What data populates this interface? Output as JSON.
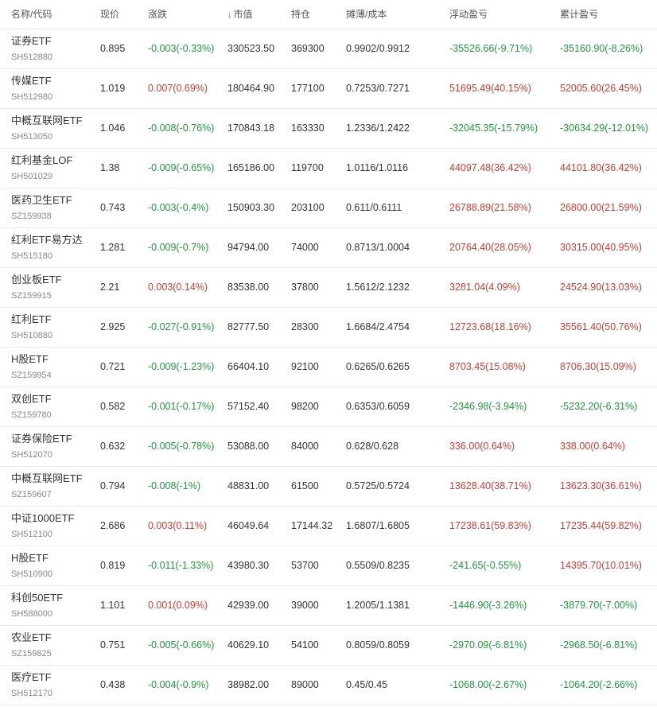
{
  "header": {
    "name_code": "名称/代码",
    "price": "现价",
    "change": "涨跌",
    "market_value": "市值",
    "holding": "持仓",
    "cost": "摊薄/成本",
    "floating_pl": "浮动盈亏",
    "total_pl": "累计盈亏",
    "sort_icon": "↓"
  },
  "colors": {
    "up": "#d43a30",
    "down": "#1f9a3c",
    "accent": "#1a73e8"
  },
  "rows": [
    {
      "name": "证券ETF",
      "code": "SH512880",
      "price": "0.895",
      "change": "-0.003(-0.33%)",
      "mv": "330523.50",
      "hold": "369300",
      "cost": "0.9902/0.9912",
      "float": "-35526.66(-9.71%)",
      "total": "-35160.90(-8.26%)"
    },
    {
      "name": "传媒ETF",
      "code": "SH512980",
      "price": "1.019",
      "change": "0.007(0.69%)",
      "mv": "180464.90",
      "hold": "177100",
      "cost": "0.7253/0.7271",
      "float": "51695.49(40.15%)",
      "total": "52005.60(26.45%)"
    },
    {
      "name": "中概互联网ETF",
      "code": "SH513050",
      "price": "1.046",
      "change": "-0.008(-0.76%)",
      "mv": "170843.18",
      "hold": "163330",
      "cost": "1.2336/1.2422",
      "float": "-32045.35(-15.79%)",
      "total": "-30634.29(-12.01%)"
    },
    {
      "name": "红利基金LOF",
      "code": "SH501029",
      "price": "1.38",
      "change": "-0.009(-0.65%)",
      "mv": "165186.00",
      "hold": "119700",
      "cost": "1.0116/1.0116",
      "float": "44097.48(36.42%)",
      "total": "44101.80(36.42%)"
    },
    {
      "name": "医药卫生ETF",
      "code": "SZ159938",
      "price": "0.743",
      "change": "-0.003(-0.4%)",
      "mv": "150903.30",
      "hold": "203100",
      "cost": "0.611/0.6111",
      "float": "26788.89(21.58%)",
      "total": "26800.00(21.59%)"
    },
    {
      "name": "红利ETF易方达",
      "code": "SH515180",
      "price": "1.281",
      "change": "-0.009(-0.7%)",
      "mv": "94794.00",
      "hold": "74000",
      "cost": "0.8713/1.0004",
      "float": "20764.40(28.05%)",
      "total": "30315.00(40.95%)"
    },
    {
      "name": "创业板ETF",
      "code": "SZ159915",
      "price": "2.21",
      "change": "0.003(0.14%)",
      "mv": "83538.00",
      "hold": "37800",
      "cost": "1.5612/2.1232",
      "float": "3281.04(4.09%)",
      "total": "24524.90(13.03%)"
    },
    {
      "name": "红利ETF",
      "code": "SH510880",
      "price": "2.925",
      "change": "-0.027(-0.91%)",
      "mv": "82777.50",
      "hold": "28300",
      "cost": "1.6684/2.4754",
      "float": "12723.68(18.16%)",
      "total": "35561.40(50.76%)"
    },
    {
      "name": "H股ETF",
      "code": "SZ159954",
      "price": "0.721",
      "change": "-0.009(-1.23%)",
      "mv": "66404.10",
      "hold": "92100",
      "cost": "0.6265/0.6265",
      "float": "8703.45(15.08%)",
      "total": "8706.30(15.09%)"
    },
    {
      "name": "双创ETF",
      "code": "SZ159780",
      "price": "0.582",
      "change": "-0.001(-0.17%)",
      "mv": "57152.40",
      "hold": "98200",
      "cost": "0.6353/0.6059",
      "float": "-2346.98(-3.94%)",
      "total": "-5232.20(-6.31%)"
    },
    {
      "name": "证券保险ETF",
      "code": "SH512070",
      "price": "0.632",
      "change": "-0.005(-0.78%)",
      "mv": "53088.00",
      "hold": "84000",
      "cost": "0.628/0.628",
      "float": "336.00(0.64%)",
      "total": "338.00(0.64%)"
    },
    {
      "name": "中概互联网ETF",
      "code": "SZ159607",
      "price": "0.794",
      "change": "-0.008(-1%)",
      "mv": "48831.00",
      "hold": "61500",
      "cost": "0.5725/0.5724",
      "float": "13628.40(38.71%)",
      "total": "13623.30(36.61%)"
    },
    {
      "name": "中证1000ETF",
      "code": "SH512100",
      "price": "2.686",
      "change": "0.003(0.11%)",
      "mv": "46049.64",
      "hold": "17144.32",
      "cost": "1.6807/1.6805",
      "float": "17238.61(59.83%)",
      "total": "17235.44(59.82%)"
    },
    {
      "name": "H股ETF",
      "code": "SH510900",
      "price": "0.819",
      "change": "-0.011(-1.33%)",
      "mv": "43980.30",
      "hold": "53700",
      "cost": "0.5509/0.8235",
      "float": "-241.65(-0.55%)",
      "total": "14395.70(10.01%)"
    },
    {
      "name": "科创50ETF",
      "code": "SH588000",
      "price": "1.101",
      "change": "0.001(0.09%)",
      "mv": "42939.00",
      "hold": "39000",
      "cost": "1.2005/1.1381",
      "float": "-1446.90(-3.26%)",
      "total": "-3879.70(-7.00%)"
    },
    {
      "name": "农业ETF",
      "code": "SZ159825",
      "price": "0.751",
      "change": "-0.005(-0.66%)",
      "mv": "40629.10",
      "hold": "54100",
      "cost": "0.8059/0.8059",
      "float": "-2970.09(-6.81%)",
      "total": "-2968.50(-6.81%)"
    },
    {
      "name": "医疗ETF",
      "code": "SH512170",
      "price": "0.438",
      "change": "-0.004(-0.9%)",
      "mv": "38982.00",
      "hold": "89000",
      "cost": "0.45/0.45",
      "float": "-1068.00(-2.67%)",
      "total": "-1064.20(-2.66%)"
    }
  ]
}
